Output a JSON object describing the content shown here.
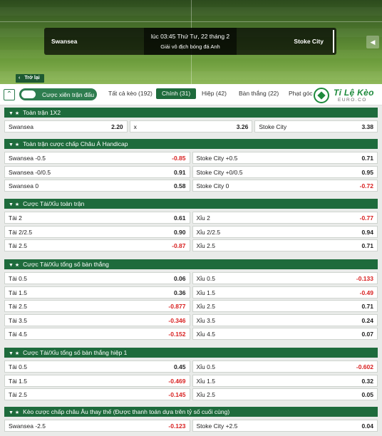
{
  "header": {
    "home": "Swansea",
    "away": "Stoke City",
    "time": "lúc 03:45 Thứ Tư, 22 tháng 2",
    "league": "Giải vô địch bóng đá Anh",
    "back_label": "Trở lại"
  },
  "tabs": {
    "toggle_label": "Cược xiên trận đấu",
    "items": [
      "Tất cả kèo (192)",
      "Chính (31)",
      "Hiệp (42)",
      "Bàn thắng (22)",
      "Phạt góc"
    ],
    "active": "Chính (31)"
  },
  "logo": {
    "title": "Tỉ Lệ Kèo",
    "sub": "EURO.CO"
  },
  "sections": [
    {
      "title": "Toàn trận 1X2",
      "rows": [
        [
          [
            "Swansea",
            "2.20"
          ],
          [
            "x",
            "3.26"
          ],
          [
            "Stoke City",
            "3.38"
          ]
        ]
      ]
    },
    {
      "title": "Toàn trận cược chấp Châu Á Handicap",
      "rows": [
        [
          [
            "Swansea -0.5",
            "-0.85"
          ],
          [
            "Stoke City +0.5",
            "0.71"
          ]
        ],
        [
          [
            "Swansea -0/0.5",
            "0.91"
          ],
          [
            "Stoke City +0/0.5",
            "0.95"
          ]
        ],
        [
          [
            "Swansea 0",
            "0.58"
          ],
          [
            "Stoke City 0",
            "-0.72"
          ]
        ]
      ]
    },
    {
      "title": "Cược Tài/Xỉu toàn trận",
      "rows": [
        [
          [
            "Tài 2",
            "0.61"
          ],
          [
            "Xỉu 2",
            "-0.77"
          ]
        ],
        [
          [
            "Tài 2/2.5",
            "0.90"
          ],
          [
            "Xỉu 2/2.5",
            "0.94"
          ]
        ],
        [
          [
            "Tài 2.5",
            "-0.87"
          ],
          [
            "Xỉu 2.5",
            "0.71"
          ]
        ]
      ]
    },
    {
      "title": "Cược Tài/Xỉu tổng số bàn thắng",
      "rows": [
        [
          [
            "Tài 0.5",
            "0.06"
          ],
          [
            "Xỉu 0.5",
            "-0.133"
          ]
        ],
        [
          [
            "Tài 1.5",
            "0.36"
          ],
          [
            "Xỉu 1.5",
            "-0.49"
          ]
        ],
        [
          [
            "Tài 2.5",
            "-0.877"
          ],
          [
            "Xỉu 2.5",
            "0.71"
          ]
        ],
        [
          [
            "Tài 3.5",
            "-0.346"
          ],
          [
            "Xỉu 3.5",
            "0.24"
          ]
        ],
        [
          [
            "Tài 4.5",
            "-0.152"
          ],
          [
            "Xỉu 4.5",
            "0.07"
          ]
        ]
      ]
    },
    {
      "title": "Cược Tài/Xỉu tổng số bàn thắng hiệp 1",
      "rows": [
        [
          [
            "Tài 0.5",
            "0.45"
          ],
          [
            "Xỉu 0.5",
            "-0.602"
          ]
        ],
        [
          [
            "Tài 1.5",
            "-0.469"
          ],
          [
            "Xỉu 1.5",
            "0.32"
          ]
        ],
        [
          [
            "Tài 2.5",
            "-0.145"
          ],
          [
            "Xỉu 2.5",
            "0.05"
          ]
        ]
      ]
    },
    {
      "title": "Kèo cược chấp châu Âu thay thế (Được thanh toán dựa trên tỷ số cuối cùng)",
      "rows": [
        [
          [
            "Swansea -2.5",
            "-0.123"
          ],
          [
            "Stoke City +2.5",
            "0.04"
          ]
        ]
      ]
    }
  ],
  "colors": {
    "header_green": "#1e6b3c",
    "negative": "#d81f1f"
  }
}
